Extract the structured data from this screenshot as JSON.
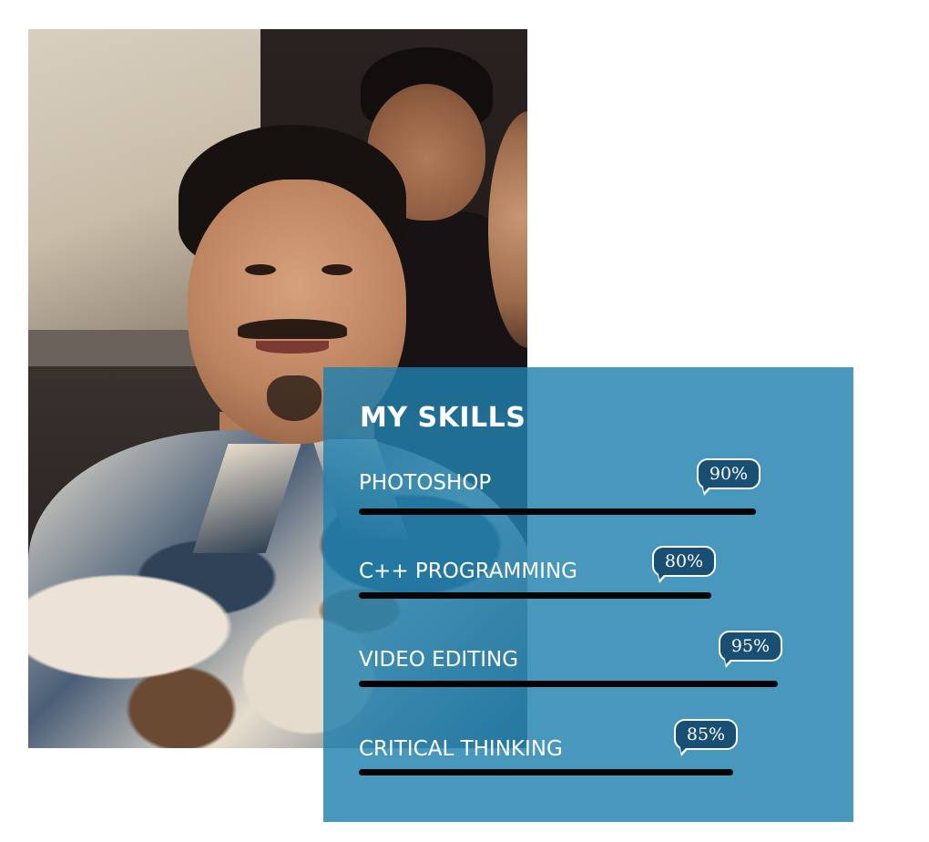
{
  "photo": {
    "description_icon": "portrait-photo"
  },
  "skills": {
    "title": "MY SKILLS",
    "items": [
      {
        "label": "PHOTOSHOP",
        "percent_label": "90%",
        "level": 0.9
      },
      {
        "label": "C++ PROGRAMMING",
        "percent_label": "80%",
        "level": 0.8
      },
      {
        "label": "VIDEO EDITING",
        "percent_label": "95%",
        "level": 0.95
      },
      {
        "label": "CRITICAL THINKING",
        "percent_label": "85%",
        "level": 0.85
      }
    ]
  },
  "colors": {
    "panel": "#2080ae",
    "bar": "#050505",
    "bubble": "#184f73",
    "text": "#ffffff"
  }
}
